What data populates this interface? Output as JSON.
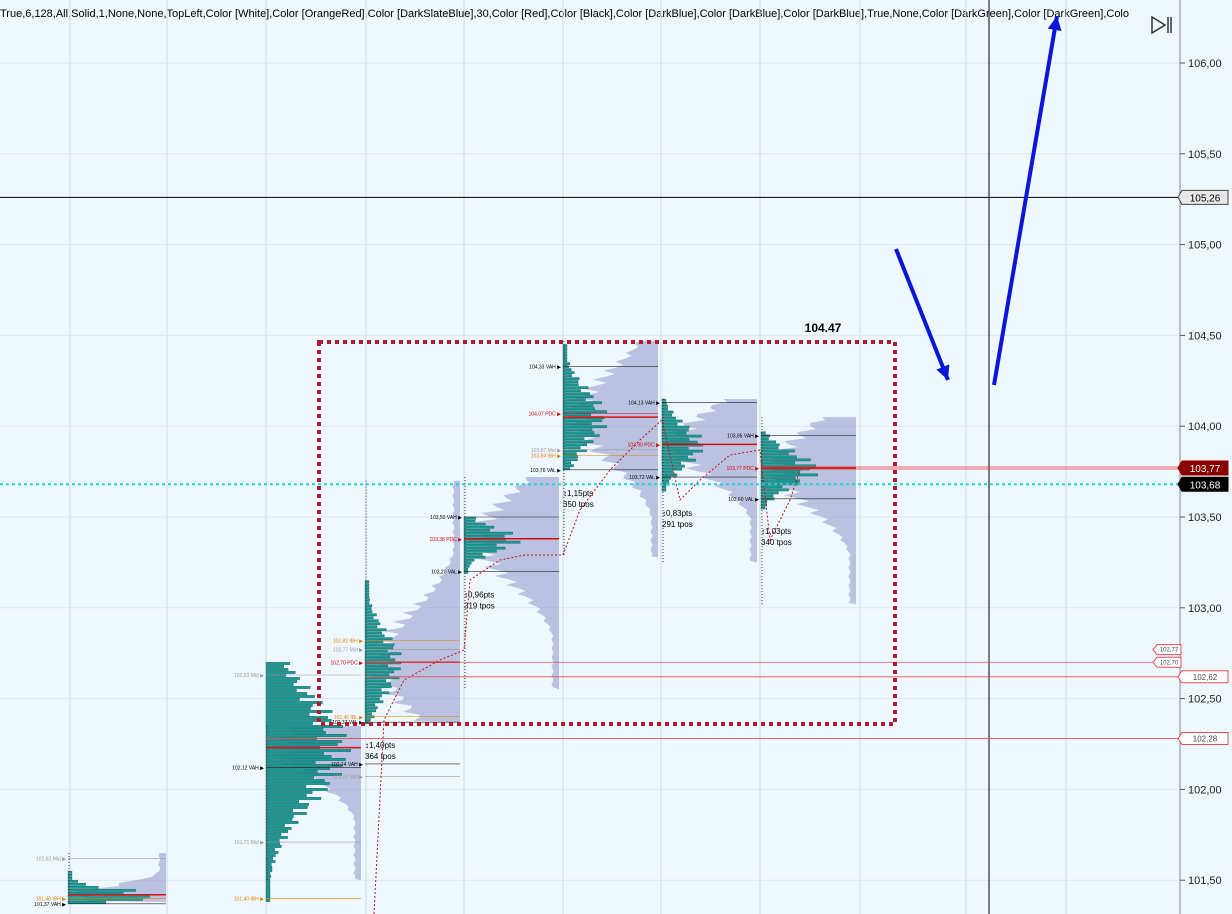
{
  "header": {
    "params_text": "True,6,128,All,Solid,1,None,None,TopLeft,Color [White],Color [OrangeRed],Color [DarkSlateBlue],30,Color [Red],Color [Black],Color [DarkBlue],Color [DarkBlue],Color [DarkBlue],True,None,Color [DarkGreen],Color [DarkGreen],Colo"
  },
  "nav": {
    "icon": "skip-to-end-icon"
  },
  "price_axis": {
    "ticks": [
      "106,00",
      "105,50",
      "105,00",
      "104,50",
      "104,00",
      "103,50",
      "103,00",
      "102,50",
      "102,00",
      "101,50"
    ],
    "markers": [
      {
        "label": "105,26",
        "style": "crosshair"
      },
      {
        "label": "103,77",
        "style": "last"
      },
      {
        "label": "103,68",
        "style": "cyan"
      },
      {
        "label": "102,77",
        "style": "small"
      },
      {
        "label": "102,70",
        "style": "small"
      },
      {
        "label": "102,62",
        "style": "red"
      },
      {
        "label": "102,28",
        "style": "red"
      }
    ]
  },
  "annotations": {
    "box_label": "104.47",
    "arrow_color": "#0b17d6",
    "box_color": "#b01c2e"
  },
  "sessions": [
    {
      "id": "s0",
      "range": "",
      "tpos": "",
      "labels": [
        {
          "t": "101,62 Mid",
          "c": "#999"
        },
        {
          "t": "101,40 IBH",
          "c": "#e08000"
        },
        {
          "t": "101,37 VAH",
          "c": "#000"
        }
      ]
    },
    {
      "id": "s1",
      "range": "",
      "tpos": "",
      "labels": [
        {
          "t": "102,63 Mid",
          "c": "#999"
        },
        {
          "t": "102,12 VAH",
          "c": "#000"
        },
        {
          "t": "101,71 Mid",
          "c": "#999"
        },
        {
          "t": "101,40 IBH",
          "c": "#e08000"
        }
      ]
    },
    {
      "id": "s2",
      "range": "↕1,40pts",
      "tpos": "364 tpos",
      "labels": [
        {
          "t": "102,77 Mid",
          "c": "#999"
        },
        {
          "t": "102,14 VAH",
          "c": "#000"
        },
        {
          "t": "102,07 Mid",
          "c": "#999"
        },
        {
          "t": "102,82 IBH",
          "c": "#e08000"
        },
        {
          "t": "102,70 PDC",
          "c": "#d00000"
        },
        {
          "t": "102,40 IBL",
          "c": "#e08000"
        },
        {
          "t": "102,37 VAL",
          "c": "#000"
        }
      ]
    },
    {
      "id": "s3",
      "range": "↕0,96pts",
      "tpos": "319 tpos",
      "labels": [
        {
          "t": "103,50 VAH",
          "c": "#000"
        },
        {
          "t": "103,38 PDC",
          "c": "#d00000"
        },
        {
          "t": "103,20 VAL",
          "c": "#000"
        }
      ]
    },
    {
      "id": "s4",
      "range": "↕1,15pts",
      "tpos": "350 tpos",
      "labels": [
        {
          "t": "104,33 VAH",
          "c": "#000"
        },
        {
          "t": "104,07 PDC",
          "c": "#d00000"
        },
        {
          "t": "103,87 Mid",
          "c": "#999"
        },
        {
          "t": "103,84 IBH",
          "c": "#e08000"
        },
        {
          "t": "103,76 VAL",
          "c": "#000"
        }
      ]
    },
    {
      "id": "s5",
      "range": "↕0,83pts",
      "tpos": "291 tpos",
      "labels": [
        {
          "t": "104,13 VAH",
          "c": "#000"
        },
        {
          "t": "103,90 PDC",
          "c": "#d00000"
        },
        {
          "t": "103,72 VAL",
          "c": "#000"
        }
      ]
    },
    {
      "id": "s6",
      "range": "↕1,03pts",
      "tpos": "340 tpos",
      "labels": [
        {
          "t": "103,95 VAH",
          "c": "#000"
        },
        {
          "t": "103,77 PDC",
          "c": "#d00000"
        },
        {
          "t": "103,60 VAL",
          "c": "#000"
        }
      ]
    }
  ]
}
